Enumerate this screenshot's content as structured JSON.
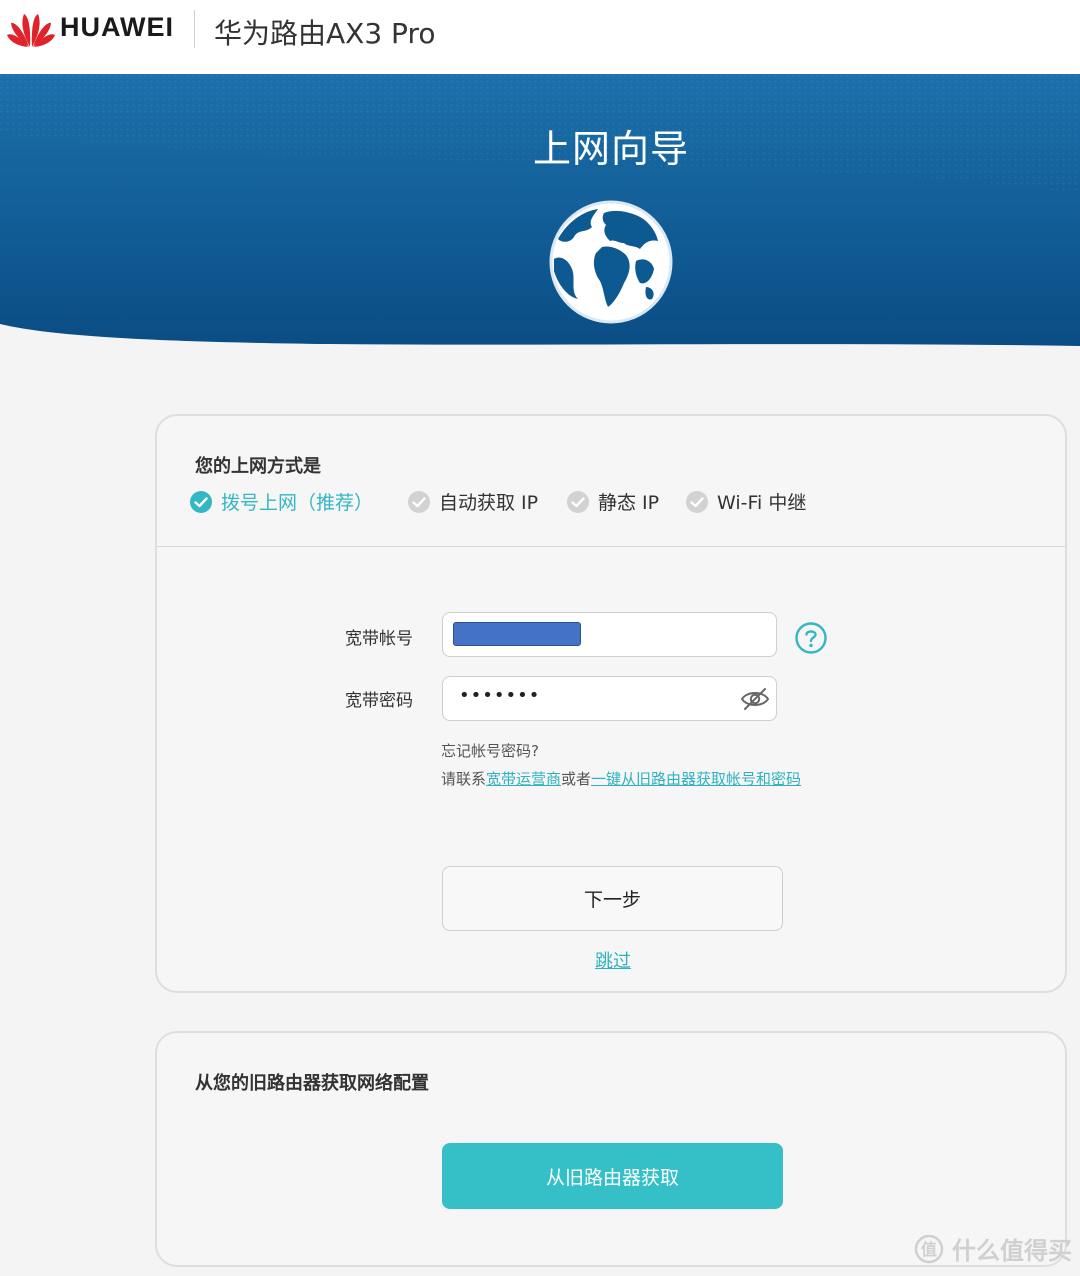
{
  "header": {
    "brand": "HUAWEI",
    "product": "华为路由AX3 Pro",
    "icons": {
      "logo": "huawei-flower-logo"
    }
  },
  "banner": {
    "title": "上网向导",
    "icon": "globe-icon",
    "colors": {
      "top": "#1b6fa8",
      "bottom": "#0a4f86"
    }
  },
  "wizard": {
    "section_title": "您的上网方式是",
    "modes": [
      {
        "label": "拨号上网（推荐）",
        "selected": true
      },
      {
        "label": "自动获取 IP",
        "selected": false
      },
      {
        "label": "静态 IP",
        "selected": false
      },
      {
        "label": "Wi-Fi 中继",
        "selected": false
      }
    ],
    "account": {
      "label": "宽带帐号",
      "value_hidden": true
    },
    "password": {
      "label": "宽带密码",
      "value": "•••••••"
    },
    "hints": {
      "forgot": "忘记帐号密码?",
      "prefix": "请联系",
      "link_isp": "宽带运营商",
      "middle": "或者",
      "link_old_router": "一键从旧路由器获取帐号和密码"
    },
    "next_label": "下一步",
    "skip_label": "跳过"
  },
  "old_router": {
    "section_title": "从您的旧路由器获取网络配置",
    "button_label": "从旧路由器获取"
  },
  "watermark": {
    "text": "什么值得买",
    "icon": "value-badge-icon"
  },
  "colors": {
    "accent": "#35bfc6",
    "link": "#2fb2c0",
    "mask": "#4472c4"
  }
}
